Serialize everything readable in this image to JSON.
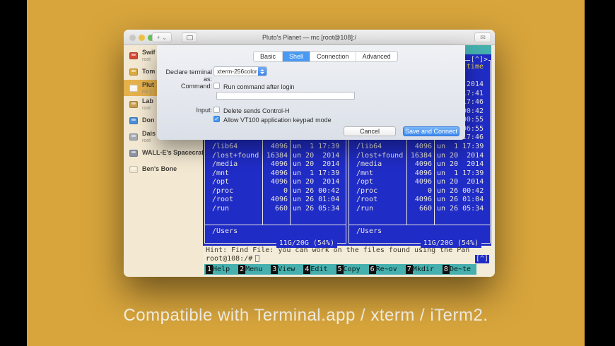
{
  "caption": "Compatible with Terminal.app / xterm / iTerm2.",
  "colors": {
    "background_gold": "#d8a53c",
    "mc_blue": "#202cc6",
    "mc_teal": "#45b0ae",
    "mc_yellow": "#e7cd3e",
    "mc_text": "#eae8e0",
    "accent_blue": "#4a9af4",
    "sidebar_selected": "#e5b14c"
  },
  "window": {
    "title": "Pluto's Planet — mc [root@108]:/"
  },
  "sidebar": {
    "items": [
      {
        "label": "Swif",
        "subtitle": "root",
        "icon_color": "#d34a38",
        "selected": false
      },
      {
        "label": "Tom",
        "subtitle": "",
        "icon_color": "#d9aa3f",
        "selected": false
      },
      {
        "label": "Plut",
        "subtitle": "mc [",
        "icon_color": "#f8f5ec",
        "selected": true
      },
      {
        "label": "Lab",
        "subtitle": "root",
        "icon_color": "#c89e50",
        "selected": false
      },
      {
        "label": "Don",
        "subtitle": "",
        "icon_color": "#4a8fd8",
        "selected": false
      },
      {
        "label": "Dais",
        "subtitle": "root",
        "icon_color": "#a7abb2",
        "selected": false
      },
      {
        "label": "WALL-E's Spacecraft",
        "subtitle": "",
        "icon_color": "#8b93a2",
        "selected": false
      },
      {
        "label": "Ben's Bone",
        "subtitle": "",
        "icon_color": "#f1e8d2",
        "selected": false
      }
    ]
  },
  "dialog": {
    "tabs": [
      {
        "label": "Basic",
        "selected": false
      },
      {
        "label": "Shell",
        "selected": true
      },
      {
        "label": "Connection",
        "selected": false
      },
      {
        "label": "Advanced",
        "selected": false
      }
    ],
    "declare_label": "Declare terminal as:",
    "declare_value": "xterm-256color",
    "command_label": "Command:",
    "command_checkbox_label": "Run command after login",
    "command_checked": false,
    "command_value": "",
    "input_label": "Input:",
    "delete_checkbox_label": "Delete sends Control-H",
    "delete_checked": false,
    "vt100_checkbox_label": "Allow VT100 application keypad mode",
    "vt100_checked": true,
    "cancel_label": "Cancel",
    "save_label": "Save and Connect"
  },
  "terminal": {
    "corner_widget": "[^]>",
    "mtime_header": "time",
    "partial_rows_mtime": [
      "",
      "2014",
      "17:41",
      "17:46",
      "00:42",
      "00:55",
      "06:55",
      "17:46"
    ],
    "files": [
      {
        "name": "/lib64",
        "size": "4096",
        "mtime": "un  1 17:39"
      },
      {
        "name": "/lost+found",
        "size": "16384",
        "mtime": "un 20  2014"
      },
      {
        "name": "/media",
        "size": "4096",
        "mtime": "un 20  2014"
      },
      {
        "name": "/mnt",
        "size": "4096",
        "mtime": "un  1 17:39"
      },
      {
        "name": "/opt",
        "size": "4096",
        "mtime": "un 20  2014"
      },
      {
        "name": "/proc",
        "size": "0",
        "mtime": "un 26 00:42"
      },
      {
        "name": "/root",
        "size": "4096",
        "mtime": "un 26 01:04"
      },
      {
        "name": "/run",
        "size": "660",
        "mtime": "un 26 05:34"
      }
    ],
    "selected_path": "/Users",
    "disk_usage": "11G/20G (54%)",
    "hint": "Hint: Find File: you can work on the files found using the Pan",
    "prompt": "root@108:/#",
    "scroll_button": "[^]",
    "fkeys": [
      {
        "num": "1",
        "label": "Help"
      },
      {
        "num": "2",
        "label": "Menu"
      },
      {
        "num": "3",
        "label": "View"
      },
      {
        "num": "4",
        "label": "Edit"
      },
      {
        "num": "5",
        "label": "Copy"
      },
      {
        "num": "6",
        "label": "Re~ov"
      },
      {
        "num": "7",
        "label": "Mkdir"
      },
      {
        "num": "8",
        "label": "De~te"
      }
    ]
  }
}
